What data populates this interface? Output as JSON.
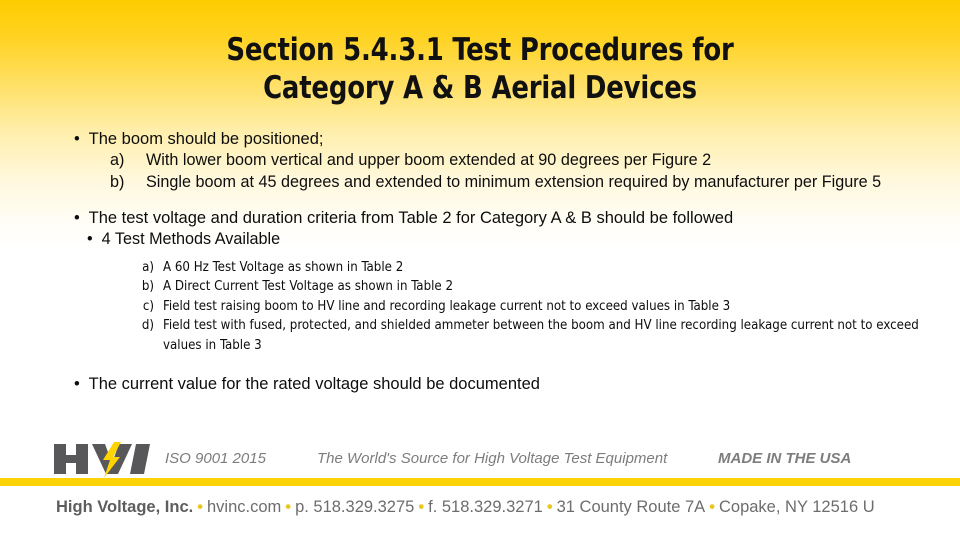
{
  "slide": {
    "title_lines": [
      "Section 5.4.3.1 Test Procedures for",
      "Category A & B Aerial Devices"
    ],
    "bullets": {
      "b1": "The boom should be positioned;",
      "b1a_marker": "a)",
      "b1a": "With lower boom vertical and upper boom extended at 90 degrees per Figure 2",
      "b1b_marker": "b)",
      "b1b": "Single boom at 45 degrees and extended to minimum extension required by manufacturer per Figure 5",
      "b2": "The test voltage and duration criteria from Table 2 for Category A & B should be followed",
      "b2sub": "4 Test Methods Available",
      "m_a_marker": "a)",
      "m_a": "A 60 Hz Test Voltage as shown in Table 2",
      "m_b_marker": "b)",
      "m_b": "A Direct Current Test Voltage as shown in Table 2",
      "m_c_marker": "c)",
      "m_c": "Field test raising boom to HV line and recording leakage current not to exceed values in Table 3",
      "m_d_marker": "d)",
      "m_d": "Field test with fused, protected, and shielded ammeter between the boom and HV line recording leakage current not to exceed values in Table 3",
      "b3": "The current value for the rated voltage should be documented",
      "bullet_glyph": "•"
    }
  },
  "footer": {
    "logo_text": "HVI",
    "iso": "ISO 9001 2015",
    "world_source": "The World's Source for High Voltage Test Equipment",
    "made_in_usa": "MADE IN THE USA",
    "company": "High Voltage, Inc.",
    "website": "hvinc.com",
    "phone": "p. 518.329.3275",
    "fax": "f. 518.329.3271",
    "street": "31 County Route 7A",
    "city_state_zip": "Copake, NY 12516 U",
    "separator": "•"
  },
  "colors": {
    "gradient_top": "#ffcc00",
    "gradient_bottom": "#ffffff",
    "divider_yellow": "#fcd307",
    "footer_gray": "#6d6d6d",
    "tagline_gray": "#7d7d7d",
    "logo_gray": "#58585a",
    "logo_bolt_yellow": "#ffd400",
    "body_text": "#0d0d0d"
  }
}
